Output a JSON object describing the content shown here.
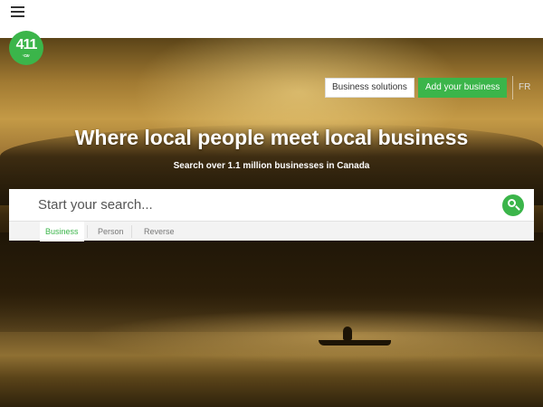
{
  "header": {
    "menu_icon": "hamburger-menu-icon"
  },
  "logo": {
    "text": "411",
    "subtext": "·ca·"
  },
  "top_actions": {
    "business_solutions": "Business solutions",
    "add_business": "Add your business",
    "language": "FR"
  },
  "hero": {
    "headline": "Where local people meet local business",
    "subheadline": "Search over 1.1 million businesses in Canada"
  },
  "search": {
    "placeholder": "Start your search...",
    "value": "",
    "button_icon": "search-icon",
    "tabs": [
      {
        "label": "Business",
        "active": true
      },
      {
        "label": "Person",
        "active": false
      },
      {
        "label": "Reverse",
        "active": false
      }
    ]
  },
  "colors": {
    "brand_green": "#3bb54a"
  }
}
